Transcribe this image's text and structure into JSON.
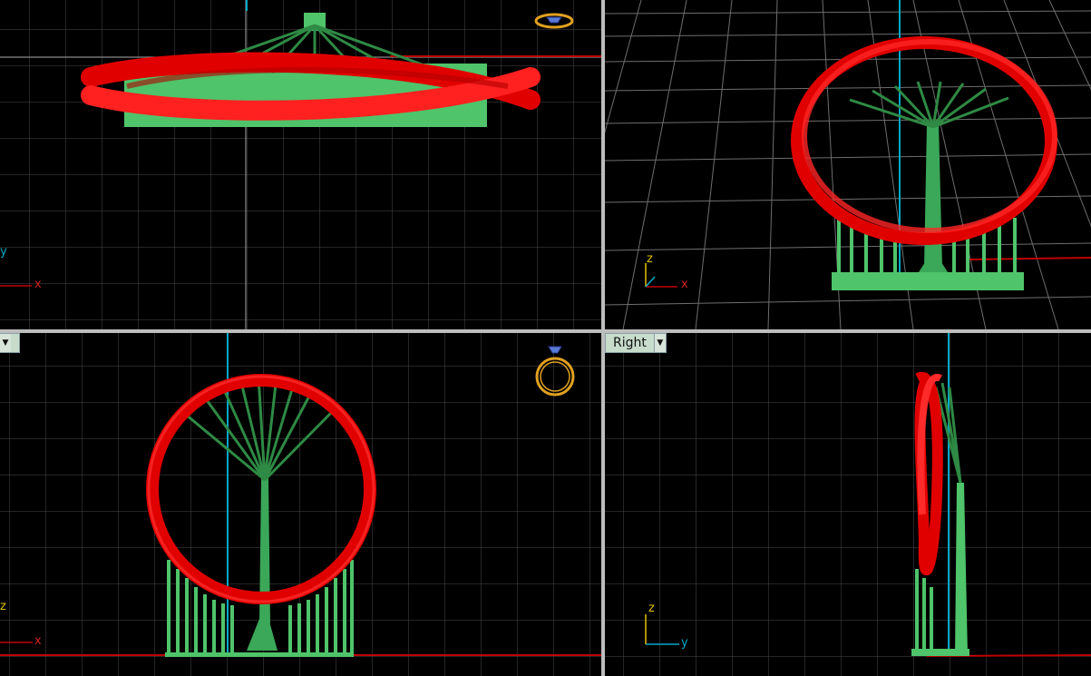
{
  "viewports": {
    "top": {
      "axis_x": "x",
      "axis_y": "y"
    },
    "perspective": {
      "axis_x": "x",
      "axis_z": "z"
    },
    "front": {
      "axis_x": "x",
      "axis_z": "z"
    },
    "right": {
      "tab_label": "Right",
      "axis_y": "y",
      "axis_z": "z"
    }
  },
  "icons": {
    "top_gem": "ring-top-view-icon",
    "front_ring": "ring-front-view-icon",
    "tab_dropdown": "chevron-down-icon"
  },
  "colors": {
    "background": "#000000",
    "grid": "#5a5a5a",
    "grid_major": "#8a8a8a",
    "model_ring": "#e00000",
    "model_supports": "#4fc46a",
    "axis_x": "#c00000",
    "axis_y": "#00a8c8",
    "axis_z": "#e0c000",
    "gizmo": "#e0a020"
  }
}
